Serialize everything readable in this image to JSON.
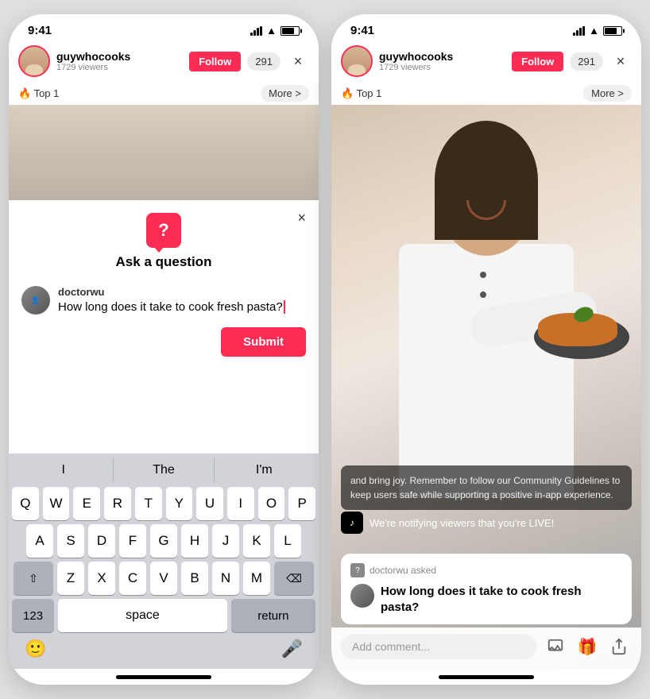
{
  "phone1": {
    "status": {
      "time": "9:41"
    },
    "header": {
      "username": "guywhocooks",
      "viewers": "1729 viewers",
      "follow_label": "Follow",
      "viewer_count": "291",
      "close": "×"
    },
    "top_bar": {
      "badge": "🔥 Top 1",
      "more": "More >"
    },
    "question_panel": {
      "title": "Ask a question",
      "close": "×",
      "questioner": "doctorwu",
      "question_text": "How long does it take to cook fresh pasta?",
      "submit_label": "Submit"
    },
    "keyboard": {
      "suggestions": [
        "I",
        "The",
        "I'm"
      ],
      "row1": [
        "Q",
        "W",
        "E",
        "R",
        "T",
        "Y",
        "U",
        "I",
        "O",
        "P"
      ],
      "row2": [
        "A",
        "S",
        "D",
        "F",
        "G",
        "H",
        "J",
        "K",
        "L"
      ],
      "row3": [
        "Z",
        "X",
        "C",
        "V",
        "B",
        "N",
        "M"
      ],
      "shift": "⇧",
      "delete": "⌫",
      "num_label": "123",
      "space_label": "space",
      "return_label": "return"
    }
  },
  "phone2": {
    "status": {
      "time": "9:41"
    },
    "header": {
      "username": "guywhocooks",
      "viewers": "1729 viewers",
      "follow_label": "Follow",
      "viewer_count": "291",
      "close": "×"
    },
    "top_bar": {
      "badge": "🔥 Top 1",
      "more": "More >"
    },
    "guidelines": "and bring joy. Remember to follow our Community Guidelines to keep users safe while supporting a positive in-app experience.",
    "live_notification": "We're notifying viewers that you're LIVE!",
    "question_card": {
      "asked_by": "doctorwu asked",
      "question": "How long does it take to cook fresh pasta?"
    },
    "comment_placeholder": "Add comment..."
  }
}
